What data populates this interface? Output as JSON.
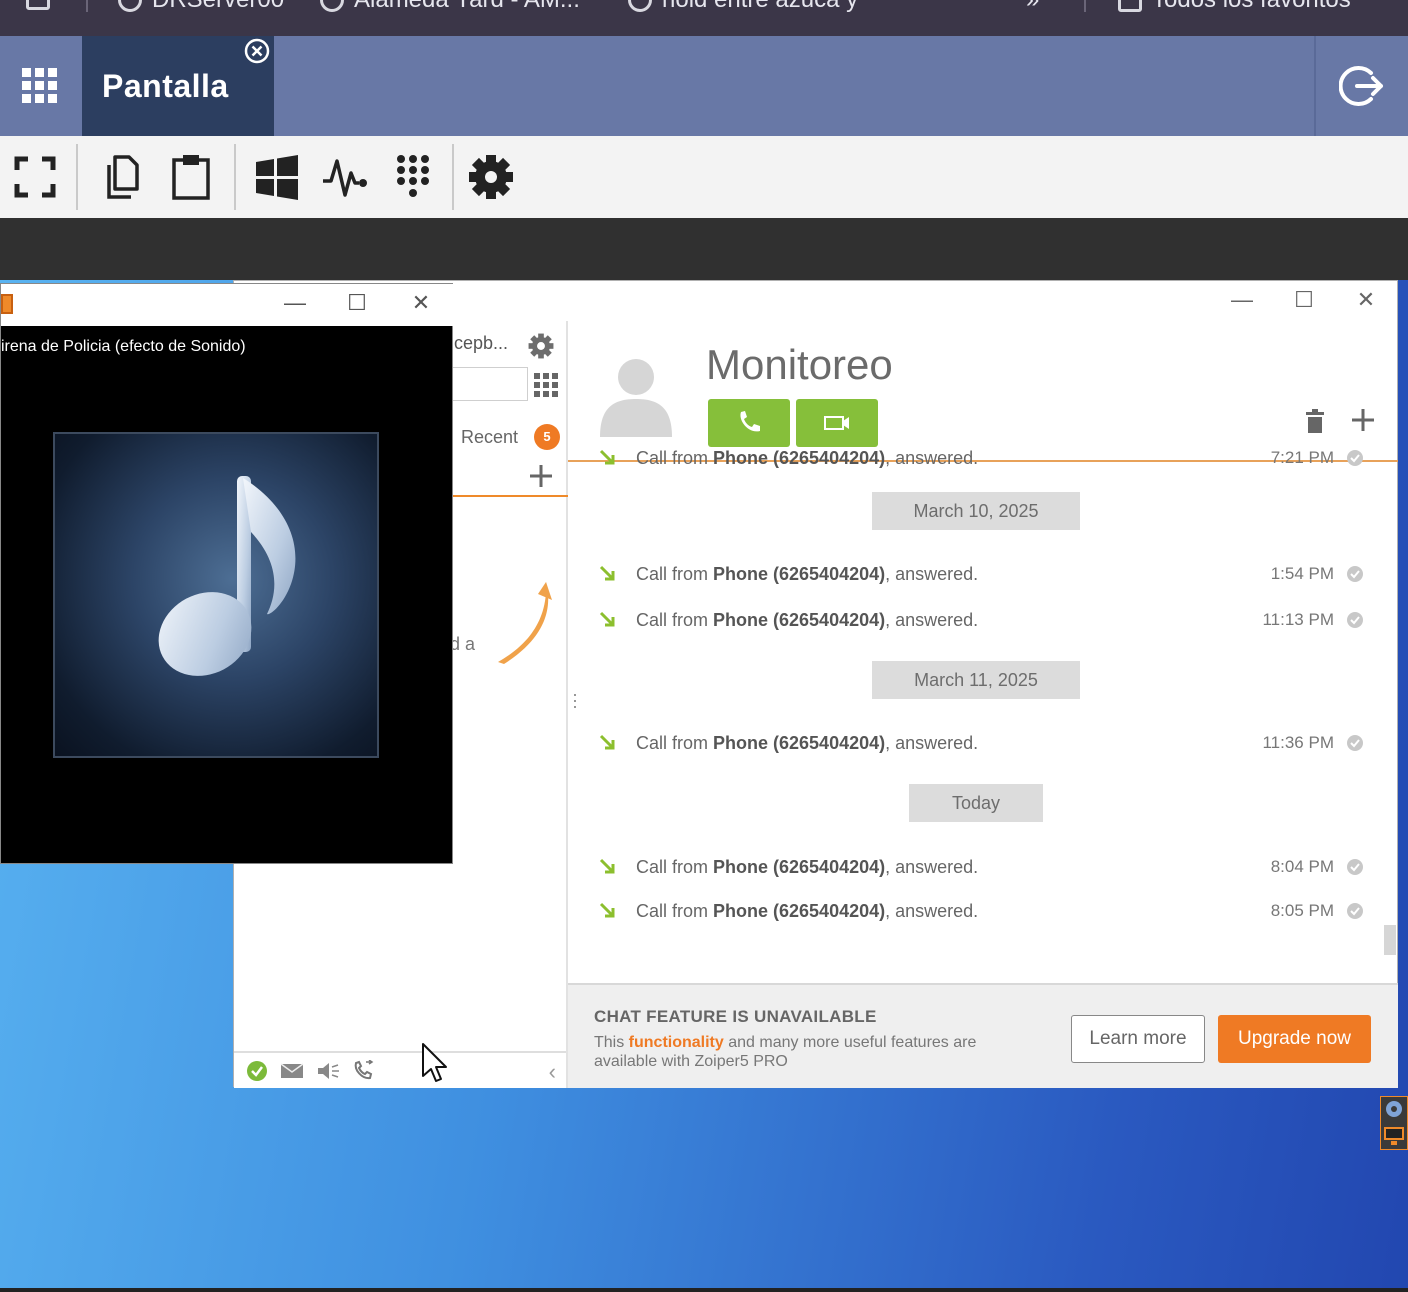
{
  "bookmarks": [
    {
      "label": "DRServer00"
    },
    {
      "label": "Alameda Yard - AM..."
    },
    {
      "label": "hold entre azuca y"
    },
    {
      "label": "Todos los favoritos"
    }
  ],
  "remote_header": {
    "tab_title": "Pantalla"
  },
  "toolbar": {
    "icons": [
      "fullscreen-icon",
      "copy-icon",
      "clipboard-icon",
      "windows-icon",
      "pulse-icon",
      "keypad-icon",
      "settings-icon"
    ]
  },
  "media_player": {
    "track_title": "irena de Policia (efecto de Sonido)",
    "controls": {
      "minimize": "—",
      "maximize": "☐",
      "close": "✕"
    }
  },
  "zoiper": {
    "window_controls": {
      "minimize": "—",
      "maximize": "☐",
      "close": "✕"
    },
    "account_label": "cepb...",
    "recent_label": "Recent",
    "recent_badge": "5",
    "hint_fragment": "d a",
    "contact_name": "Monitoreo",
    "history": [
      {
        "type": "call",
        "prefix": "Call from ",
        "caller": "Phone (6265404204)",
        "suffix": ", answered.",
        "time": "7:21 PM"
      },
      {
        "type": "date",
        "label": "March 10, 2025"
      },
      {
        "type": "call",
        "prefix": "Call from ",
        "caller": "Phone (6265404204)",
        "suffix": ", answered.",
        "time": "1:54 PM"
      },
      {
        "type": "call",
        "prefix": "Call from ",
        "caller": "Phone (6265404204)",
        "suffix": ", answered.",
        "time": "11:13 PM"
      },
      {
        "type": "date",
        "label": "March 11, 2025"
      },
      {
        "type": "call",
        "prefix": "Call from ",
        "caller": "Phone (6265404204)",
        "suffix": ", answered.",
        "time": "11:36 PM"
      },
      {
        "type": "date",
        "label": "Today"
      },
      {
        "type": "call",
        "prefix": "Call from ",
        "caller": "Phone (6265404204)",
        "suffix": ", answered.",
        "time": "8:04 PM"
      },
      {
        "type": "call",
        "prefix": "Call from ",
        "caller": "Phone (6265404204)",
        "suffix": ", answered.",
        "time": "8:05 PM"
      }
    ],
    "promo": {
      "title": "CHAT FEATURE IS UNAVAILABLE",
      "text_before": "This ",
      "text_highlight": "functionality",
      "text_after": " and many more useful features are available with Zoiper5 PRO",
      "learn_more": "Learn more",
      "upgrade_now": "Upgrade now"
    }
  },
  "colors": {
    "header_bg": "#6878a6",
    "tab_active_bg": "#2c3e60",
    "call_green": "#86bf3a",
    "accent_orange": "#ef7a24"
  }
}
